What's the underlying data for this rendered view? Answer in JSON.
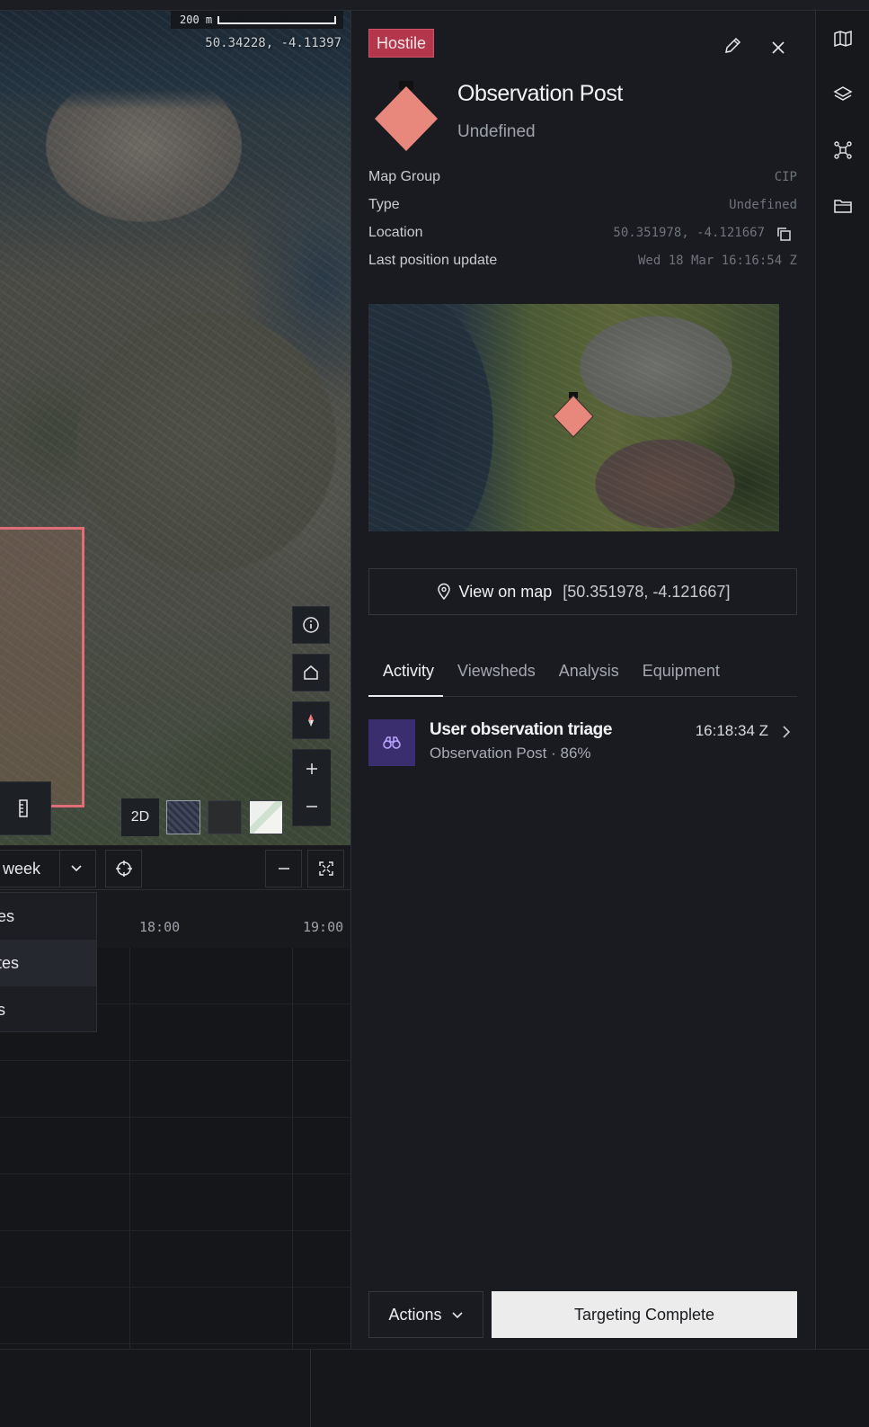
{
  "map": {
    "scale_label": "200 m",
    "cursor_coords": "50.34228, -4.11397",
    "view_mode": "2D",
    "basemaps": [
      "satellite",
      "dark",
      "light"
    ],
    "controls": [
      "info-icon",
      "home-icon",
      "compass-icon",
      "zoom-in-icon",
      "zoom-out-icon"
    ]
  },
  "timeline": {
    "range_label": "week",
    "times": [
      "18:00",
      "19:00"
    ],
    "dropdown_items": [
      "es",
      "tes",
      "s"
    ],
    "active_dropdown_index": 1
  },
  "panel": {
    "affiliation_badge": "Hostile",
    "title": "Observation Post",
    "subtitle": "Undefined",
    "properties": {
      "map_group_label": "Map Group",
      "map_group_value": "CIP",
      "type_label": "Type",
      "type_value": "Undefined",
      "location_label": "Location",
      "location_value": "50.351978, -4.121667",
      "last_update_label": "Last position update",
      "last_update_value": "Wed 18 Mar 16:16:54 Z"
    },
    "view_on_map_label": "View on map",
    "view_on_map_coords": "[50.351978, -4.121667]",
    "tabs": [
      "Activity",
      "Viewsheds",
      "Analysis",
      "Equipment"
    ],
    "active_tab": "Activity",
    "activity": [
      {
        "title": "User observation triage",
        "subtitle": "Observation Post · 86%",
        "time": "16:18:34 Z",
        "icon": "binoculars-icon"
      }
    ],
    "actions_label": "Actions",
    "primary_action_label": "Targeting Complete"
  },
  "rail": {
    "icons": [
      "map-icon",
      "layers-icon",
      "network-icon",
      "folder-icon"
    ]
  },
  "colors": {
    "hostile": "#b3364a",
    "hostile_symbol": "#e8877b",
    "area_outline": "#e06d78",
    "activity_icon_bg": "#3a2e6f",
    "primary_button": "#ececec"
  }
}
